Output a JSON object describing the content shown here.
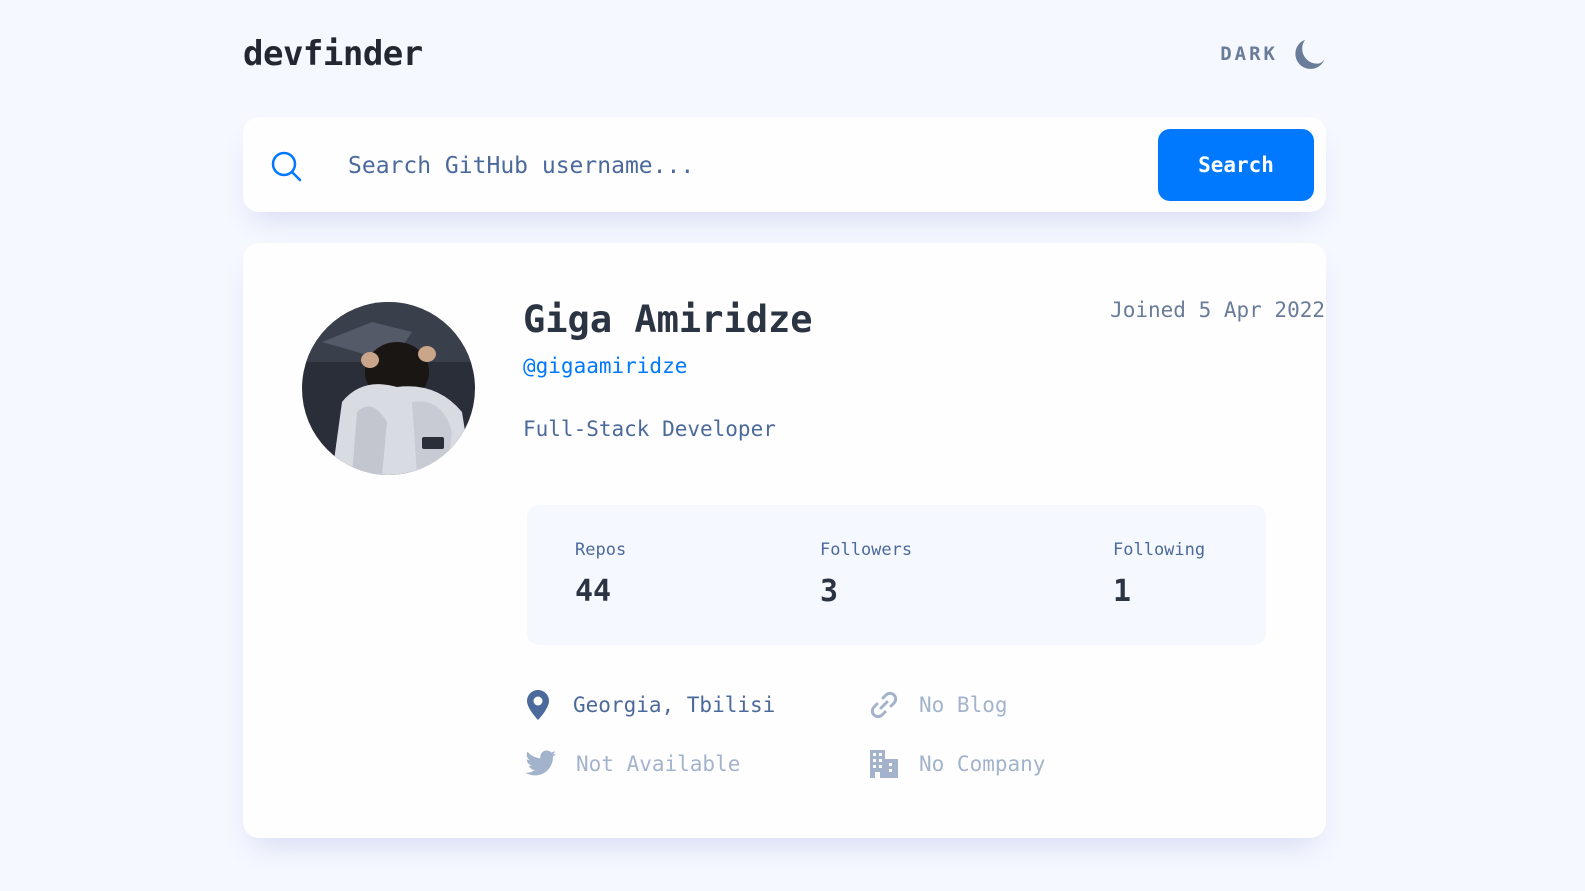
{
  "header": {
    "logo": "devfinder",
    "theme_label": "DARK",
    "theme_icon": "moon-icon"
  },
  "search": {
    "placeholder": "Search GitHub username...",
    "button_label": "Search",
    "icon": "search-icon"
  },
  "profile": {
    "name": "Giga Amiridze",
    "handle": "@gigaamiridze",
    "joined": "Joined 5 Apr 2022",
    "bio": "Full-Stack Developer"
  },
  "stats": {
    "repos_label": "Repos",
    "repos_value": "44",
    "followers_label": "Followers",
    "followers_value": "3",
    "following_label": "Following",
    "following_value": "1"
  },
  "links": {
    "location": "Georgia, Tbilisi",
    "blog": "No Blog",
    "twitter": "Not Available",
    "company": "No Company"
  },
  "colors": {
    "accent": "#0079FF",
    "background": "#F6F8FF",
    "card": "#FEFEFE",
    "text_primary": "#2B3442",
    "text_secondary": "#4B6A9B"
  }
}
